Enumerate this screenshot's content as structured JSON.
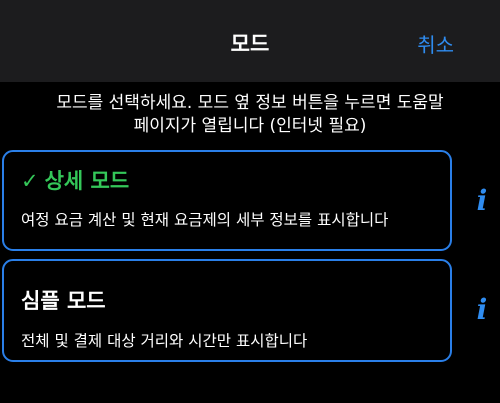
{
  "nav": {
    "title": "모드",
    "cancel_label": "취소"
  },
  "intro": {
    "line1": "모드를 선택하세요. 모드 옆 정보 버튼을 누르면 도움말",
    "line2": "페이지가 열립니다 (인터넷 필요)"
  },
  "modes": [
    {
      "check": "✓",
      "name": "상세 모드",
      "description": "여정 요금 계산 및 현재 요금제의 세부 정보를 표시합니다",
      "selected": true
    },
    {
      "name": "심플 모드",
      "description": "전체 및 결제 대상 거리와 시간만 표시합니다",
      "selected": false
    }
  ],
  "info_icon_glyph": "i",
  "colors": {
    "accent": "#2f8cf0",
    "selected": "#34c759",
    "card_border": "#2a7fe8",
    "nav_bg": "#1c1c1e",
    "background": "#000000"
  }
}
